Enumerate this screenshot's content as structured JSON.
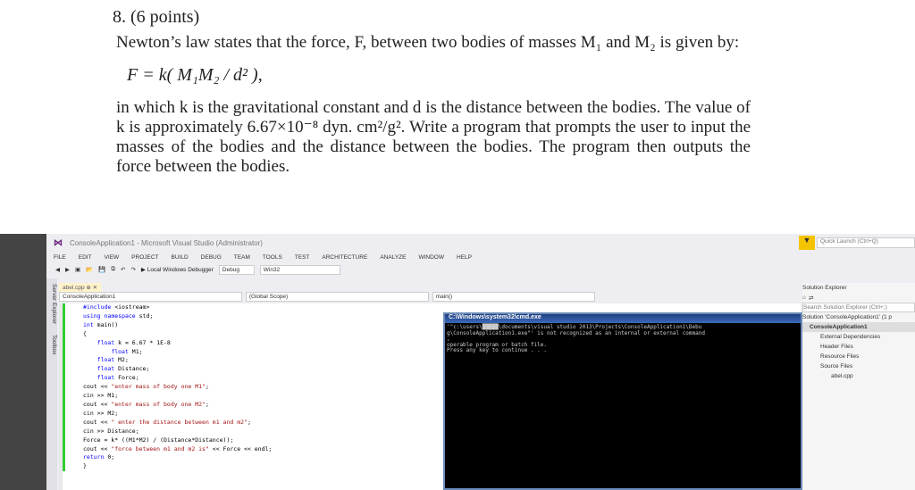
{
  "problem": {
    "heading": "8. (6 points)",
    "intro": "Newton’s law states that the force, F, between two bodies of masses M₁ and M₂ is given by:",
    "equation": "F = k( M₁M₂ / d² ),",
    "body": "in which k is the gravitational constant and d is the distance between the bodies. The value of k is approximately 6.67×10⁻⁸ dyn. cm²/g². Write a program that prompts the user to input the masses of the bodies and the distance between the bodies. The program then outputs the force between the bodies."
  },
  "vs": {
    "title": "ConsoleApplication1 - Microsoft Visual Studio (Administrator)",
    "quick_launch": "Quick Launch (Ctrl+Q)",
    "menu": [
      "FILE",
      "EDIT",
      "VIEW",
      "PROJECT",
      "BUILD",
      "DEBUG",
      "TEAM",
      "TOOLS",
      "TEST",
      "ARCHITECTURE",
      "ANALYZE",
      "WINDOW",
      "HELP"
    ],
    "debugger": "▶ Local Windows Debugger",
    "config": "Debug",
    "platform": "Win32",
    "side_tabs": [
      "Server Explorer",
      "Toolbox"
    ],
    "file_tab": "abel.cpp ⊕ ✕",
    "nav_project": "ConsoleApplication1",
    "nav_scope": "(Global Scope)",
    "nav_member": "main()",
    "code": [
      "#include <iostream>",
      "using namespace std;",
      "int main()",
      "{",
      "    float k = 6.67 * 1E-8",
      "        float M1;",
      "    float M2;",
      "    float Distance;",
      "    float Force;",
      "cout << \"enter mass of body one M1\";",
      "cin >> M1;",
      "cout << \"enter mass of body one M2\";",
      "cin >> M2;",
      "cout << \" enter the distance between m1 and m2\";",
      "cin >> Distance;",
      "Force = k* ((M1*M2) / (Distance*Distance));",
      "cout << \"force between m1 and m2 is\" << Force << endl;",
      "return 0;",
      "}"
    ]
  },
  "cmd": {
    "title": "C:\\Windows\\system32\\cmd.exe",
    "output": "'\"c:\\users\\█████\\documents\\visual studio 2013\\Projects\\ConsoleApplication1\\Debu\ng\\ConsoleApplication1.exe\"' is not recognized as an internal or external command\n,\noperable program or batch file.\nPress any key to continue . . ."
  },
  "solution_explorer": {
    "title": "Solution Explorer",
    "search": "Search Solution Explorer (Ctrl+;)",
    "items": [
      "Solution 'ConsoleApplication1' (1 p",
      "ConsoleApplication1",
      "External Dependencies",
      "Header Files",
      "Resource Files",
      "Source Files",
      "abel.cpp"
    ]
  }
}
